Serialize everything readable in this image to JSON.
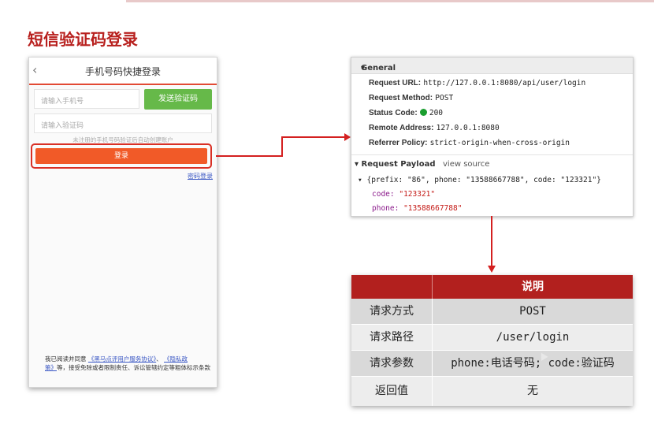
{
  "slide": {
    "title": "短信验证码登录"
  },
  "phone": {
    "header_title": "手机号码快捷登录",
    "back_icon": "chevron-left-icon",
    "phone_placeholder": "请输入手机号",
    "send_code_label": "发送验证码",
    "code_placeholder": "请输入验证码",
    "hint": "未注册的手机号码验证后自动创建账户",
    "login_label": "登录",
    "password_login_link": "密码登录",
    "agreement_prefix": "我已阅读并同意",
    "agreement_link1": "《黑马点评用户服务协议》",
    "agreement_sep": "、",
    "agreement_link2a": "《隐私政",
    "agreement_link2b": "策》",
    "agreement_suffix": "等，接受免除或者限制责任、诉讼管辖约定等粗体标示条款"
  },
  "devtools": {
    "general_label": "General",
    "request_url_key": "Request URL:",
    "request_url": "http://127.0.0.1:8080/api/user/login",
    "request_method_key": "Request Method:",
    "request_method": "POST",
    "status_code_key": "Status Code:",
    "status_code": "200",
    "status_color": "#1a9e2f",
    "remote_address_key": "Remote Address:",
    "remote_address": "127.0.0.1:8080",
    "referrer_policy_key": "Referrer Policy:",
    "referrer_policy": "strict-origin-when-cross-origin",
    "payload_label": "Request Payload",
    "view_source": "view source",
    "payload_summary": "{prefix: \"86\", phone: \"13588667788\", code: \"123321\"}",
    "payload_code_key": "code:",
    "payload_code": "\"123321\"",
    "payload_phone_key": "phone:",
    "payload_phone": "\"13588667788\""
  },
  "table": {
    "header": "说明",
    "header_color": "#b2201e",
    "rows": [
      {
        "key": "请求方式",
        "value": "POST"
      },
      {
        "key": "请求路径",
        "value": "/user/login"
      },
      {
        "key": "请求参数",
        "value": "phone:电话号码; code:验证码"
      },
      {
        "key": "返回值",
        "value": "无"
      }
    ]
  }
}
